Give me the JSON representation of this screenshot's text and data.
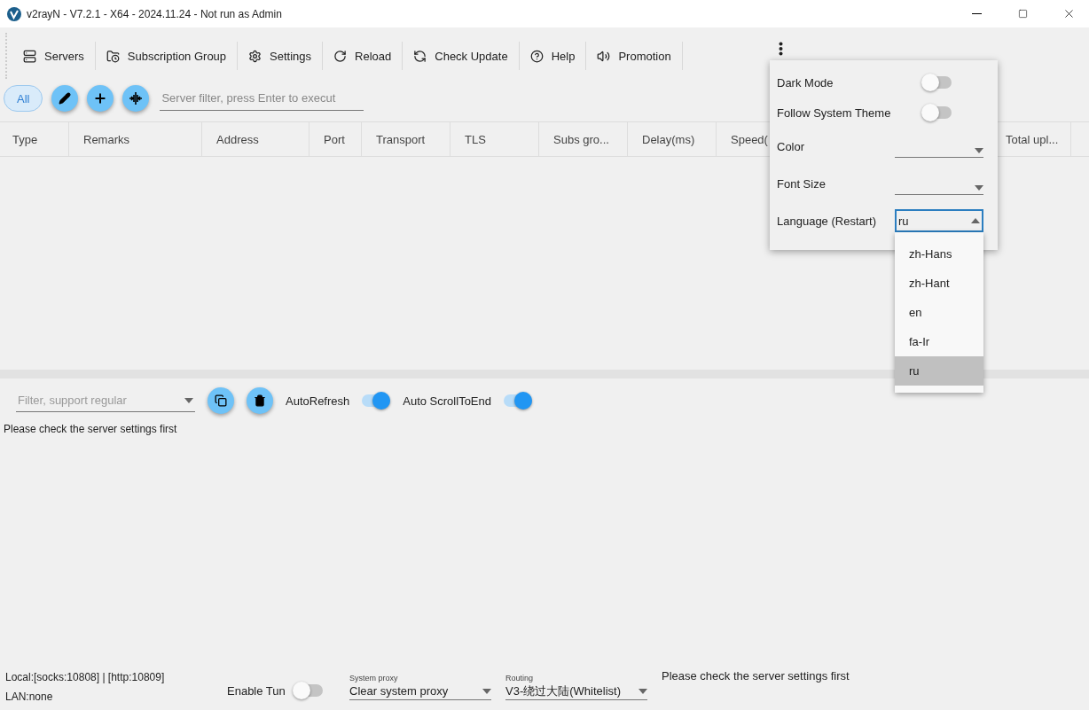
{
  "window": {
    "title": "v2rayN - V7.2.1 - X64 - 2024.11.24 - Not run as Admin"
  },
  "toolbar": [
    {
      "label": "Servers"
    },
    {
      "label": "Subscription Group"
    },
    {
      "label": "Settings"
    },
    {
      "label": "Reload"
    },
    {
      "label": "Check Update"
    },
    {
      "label": "Help"
    },
    {
      "label": "Promotion"
    }
  ],
  "filter_bar": {
    "groups": [
      {
        "label": "All",
        "selected": true
      }
    ],
    "search": {
      "placeholder": "Server filter, press Enter to execut"
    }
  },
  "table": {
    "columns": [
      "Type",
      "Remarks",
      "Address",
      "Port",
      "Transport",
      "TLS",
      "Subs gro...",
      "Delay(ms)",
      "Speed(",
      "Total upl..."
    ]
  },
  "log_bar": {
    "filter": {
      "placeholder": "Filter, support regular"
    },
    "toggles": [
      {
        "label": "AutoRefresh",
        "on": true
      },
      {
        "label": "Auto ScrollToEnd",
        "on": true
      }
    ]
  },
  "log": {
    "text": "Please check the server settings first"
  },
  "status_bar": {
    "local": "Local:[socks:10808] | [http:10809]",
    "lan": "LAN:none",
    "tun": {
      "label": "Enable Tun",
      "on": false
    },
    "system_proxy": {
      "label": "System proxy",
      "value": "Clear system proxy"
    },
    "routing": {
      "label": "Routing",
      "value": "V3-绕过大陆(Whitelist)"
    },
    "message": "Please check the server settings first"
  },
  "settings_popup": {
    "items": [
      {
        "kind": "toggle",
        "label": "Dark Mode",
        "on": false
      },
      {
        "kind": "toggle",
        "label": "Follow System Theme",
        "on": false
      },
      {
        "kind": "select",
        "label": "Color"
      },
      {
        "kind": "select",
        "label": "Font Size"
      },
      {
        "kind": "select",
        "label": "Language (Restart)",
        "value": "ru",
        "expanded": true,
        "options": [
          {
            "label": "zh-Hans",
            "selected": false
          },
          {
            "label": "zh-Hant",
            "selected": false
          },
          {
            "label": "en",
            "selected": false
          },
          {
            "label": "fa-Ir",
            "selected": false
          },
          {
            "label": "ru",
            "selected": true
          }
        ]
      }
    ]
  }
}
